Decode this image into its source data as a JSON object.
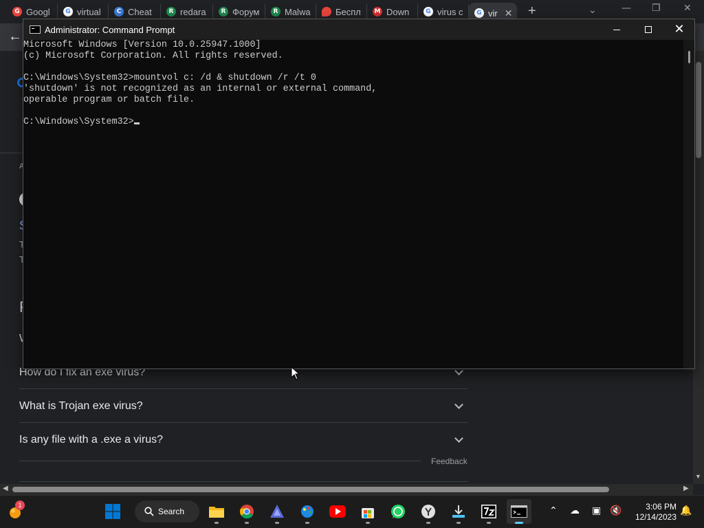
{
  "browser": {
    "tabs": [
      {
        "title": "Googl",
        "icon": "google-classroom-icon",
        "color": "#e8453c"
      },
      {
        "title": "virtual",
        "icon": "google-icon",
        "color": "#4285f4"
      },
      {
        "title": "Cheat",
        "icon": "cheat-site-icon",
        "color": "#3a7bd5"
      },
      {
        "title": "redara",
        "icon": "forum-icon",
        "color": "#1f8a4c"
      },
      {
        "title": "Форум",
        "icon": "forum-icon",
        "color": "#1f8a4c"
      },
      {
        "title": "Malwa",
        "icon": "forum-icon",
        "color": "#1f8a4c"
      },
      {
        "title": "Беспл",
        "icon": "pin-icon",
        "color": "#e8453c"
      },
      {
        "title": "Down",
        "icon": "malwarebytes-icon",
        "color": "#d32f2f"
      },
      {
        "title": "virus c",
        "icon": "google-icon",
        "color": "#4285f4"
      },
      {
        "title": "vir",
        "icon": "google-icon",
        "color": "#4285f4",
        "active": true
      }
    ],
    "new_tab": "+",
    "close_tab": "✕"
  },
  "page": {
    "glimpses": [
      "A",
      "S",
      "T",
      "T",
      "P",
      "W"
    ],
    "faq": [
      "How do I fix an exe virus?",
      "What is Trojan exe virus?",
      "Is any file with a .exe a virus?"
    ],
    "feedback": "Feedback"
  },
  "cmd": {
    "title": "Administrator: Command Prompt",
    "lines": [
      "Microsoft Windows [Version 10.0.25947.1000]",
      "(c) Microsoft Corporation. All rights reserved.",
      "",
      "C:\\Windows\\System32>mountvol c: /d & shutdown /r /t 0",
      "'shutdown' is not recognized as an internal or external command,",
      "operable program or batch file.",
      "",
      "C:\\Windows\\System32>"
    ]
  },
  "taskbar": {
    "search_label": "Search",
    "widget_badge": "1",
    "apps": [
      "windows-start-icon",
      "file-explorer-icon",
      "chrome-icon",
      "affinity-icon",
      "paint-icon",
      "youtube-icon",
      "store-icon",
      "whatsapp-icon",
      "yandex-icon",
      "downloads-icon",
      "7zip-icon",
      "terminal-icon"
    ],
    "time": "3:06 PM",
    "date": "12/14/2023",
    "colors": {
      "accent": "#0078d4",
      "youtube": "#ff0000",
      "whatsapp": "#25d366"
    }
  }
}
